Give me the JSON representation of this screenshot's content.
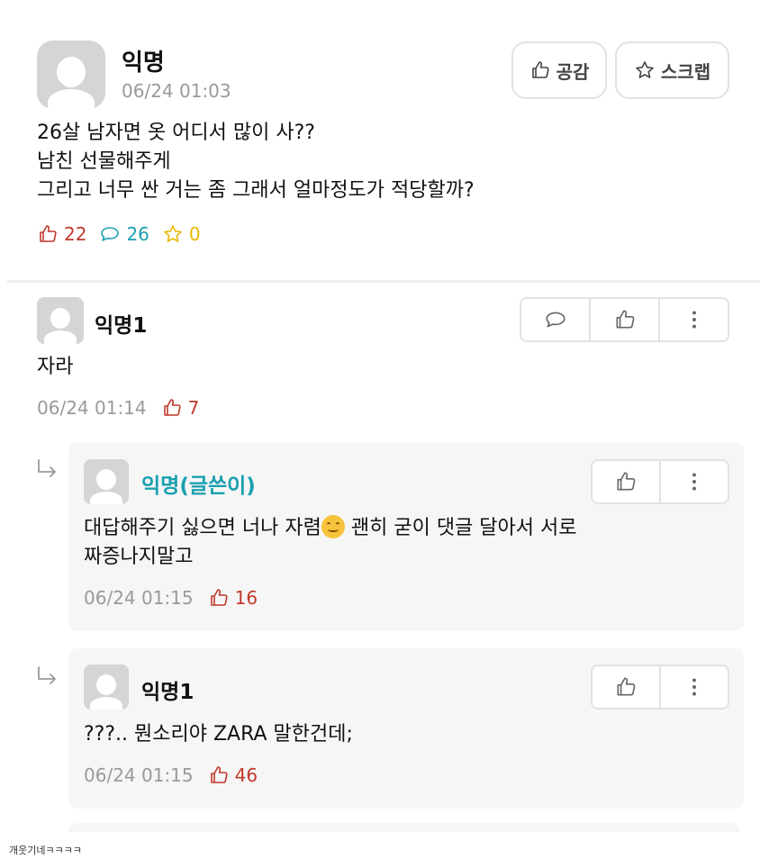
{
  "post": {
    "author": "익명",
    "time": "06/24 01:03",
    "empathy_label": "공감",
    "scrap_label": "스크랩",
    "lines": [
      "26살 남자면 옷 어디서 많이 사??",
      "남친 선물해주게",
      "그리고 너무 싼 거는 좀 그래서 얼마정도가 적당할까?"
    ],
    "likes": "22",
    "comments": "26",
    "scraps": "0"
  },
  "comments": [
    {
      "author": "익명1",
      "text": "자라",
      "time": "06/24 01:14",
      "likes": "7"
    }
  ],
  "replies": [
    {
      "author": "익명(글쓴이)",
      "author_color": "#1aa0b0",
      "text_line1_a": "대답해주기 싫으면 너나 자렴",
      "text_line1_b": " 괜히 굳이 댓글 달아서 서로",
      "text_line2": "짜증나지말고",
      "time": "06/24 01:15",
      "likes": "16"
    },
    {
      "author": "익명1",
      "text": "???.. 뭔소리야 ZARA 말한건데;",
      "time": "06/24 01:15",
      "likes": "46"
    }
  ],
  "caption": "개웃기네ㅋㅋㅋㅋ",
  "colors": {
    "like": "#c0392b",
    "comment": "#1aa0b0",
    "scrap": "#e8b800"
  },
  "icons": {
    "like": "thumbs-up-icon",
    "comment": "speech-bubble-icon",
    "scrap": "star-icon",
    "more": "more-vertical-icon",
    "reply": "reply-arrow-icon"
  }
}
